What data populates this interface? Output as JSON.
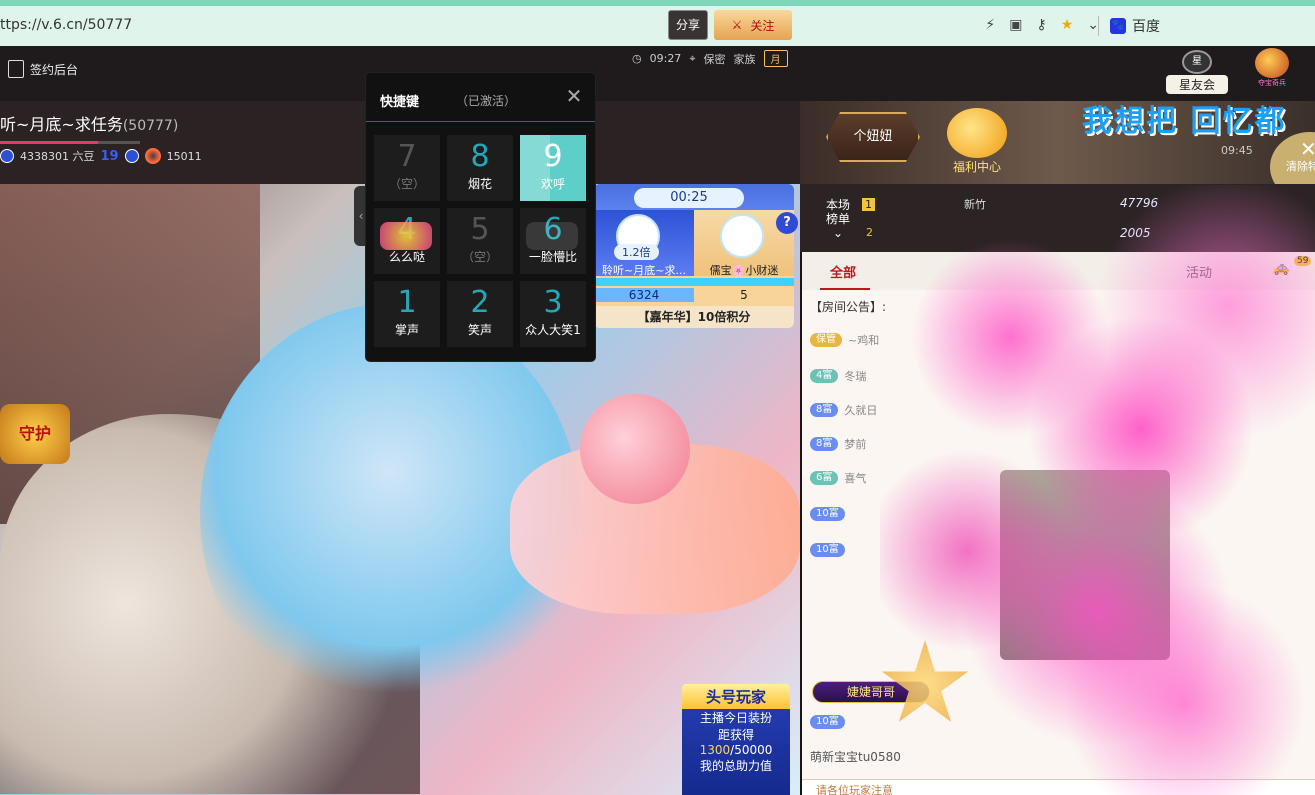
{
  "browser": {
    "url": "ttps://v.6.cn/50777",
    "bookmark": "百度"
  },
  "header": {
    "contract_label": "签约后台",
    "star_club_label": "星友会",
    "star_club_logo": "星",
    "treasure_label": "夺宝奇兵"
  },
  "room": {
    "title": "听~月底~求任务",
    "room_id": "(50777)",
    "beans": "4338301 六豆",
    "level": "19",
    "heat": "15011",
    "share": "分享",
    "follow": "关注",
    "time": "09:27",
    "location": "保密",
    "family_label": "家族",
    "family_badge": "月"
  },
  "shortcut_panel": {
    "title": "快捷键",
    "status": "（已激活）",
    "keys": [
      {
        "num": "7",
        "label": "（空）"
      },
      {
        "num": "8",
        "label": "烟花"
      },
      {
        "num": "9",
        "label": "欢呼"
      },
      {
        "num": "4",
        "label": "么么哒"
      },
      {
        "num": "5",
        "label": "（空）"
      },
      {
        "num": "6",
        "label": "一脸懵比"
      },
      {
        "num": "1",
        "label": "掌声"
      },
      {
        "num": "2",
        "label": "笑声"
      },
      {
        "num": "3",
        "label": "众人大笑1"
      }
    ]
  },
  "pk": {
    "time": "00:25",
    "multiplier": "1.2倍",
    "left_name": "聆听~月底~求...",
    "right_name": "儒宝🌸小财迷",
    "left_score": "6324",
    "right_score": "5",
    "footer": "【嘉年华】10倍积分",
    "help": "?"
  },
  "video": {
    "guard_text": "守护",
    "top_player": {
      "title": "头号玩家",
      "line1": "主播今日装扮",
      "line2": "距获得",
      "progress_current": "1300",
      "progress_total": "/50000",
      "line3": "我的总助力值"
    }
  },
  "right": {
    "niuniu": "个妞妞",
    "welfare": "福利中心",
    "scroll_text": "我想把 回忆都",
    "time": "09:45",
    "clear_label": "清除特",
    "rank_label_1": "本场",
    "rank_label_2": "榜单",
    "rank_n1": "1",
    "rank_n2": "2",
    "rank_score_1": "47796",
    "rank_score_2": "2005",
    "rank_user_1": "新竹",
    "car_count": "59"
  },
  "chat": {
    "tabs": [
      "全部",
      "活动"
    ],
    "notice": "【房间公告】:",
    "messages": [
      {
        "badge": "保管",
        "text": "~鸡和"
      },
      {
        "badge": "4富",
        "text": "冬瑞"
      },
      {
        "badge": "8富",
        "text": "久就日"
      },
      {
        "badge": "8富",
        "text": "梦前"
      },
      {
        "badge": "6富",
        "text": "喜气"
      },
      {
        "badge": "10富",
        "text": ""
      },
      {
        "badge": "10富",
        "text": ""
      }
    ],
    "greet_pill": "婕婕哥哥",
    "greet_badge": "10富",
    "bottom_user": "萌新宝宝tu0580",
    "bottom_notice": "请各位玩家注意"
  }
}
